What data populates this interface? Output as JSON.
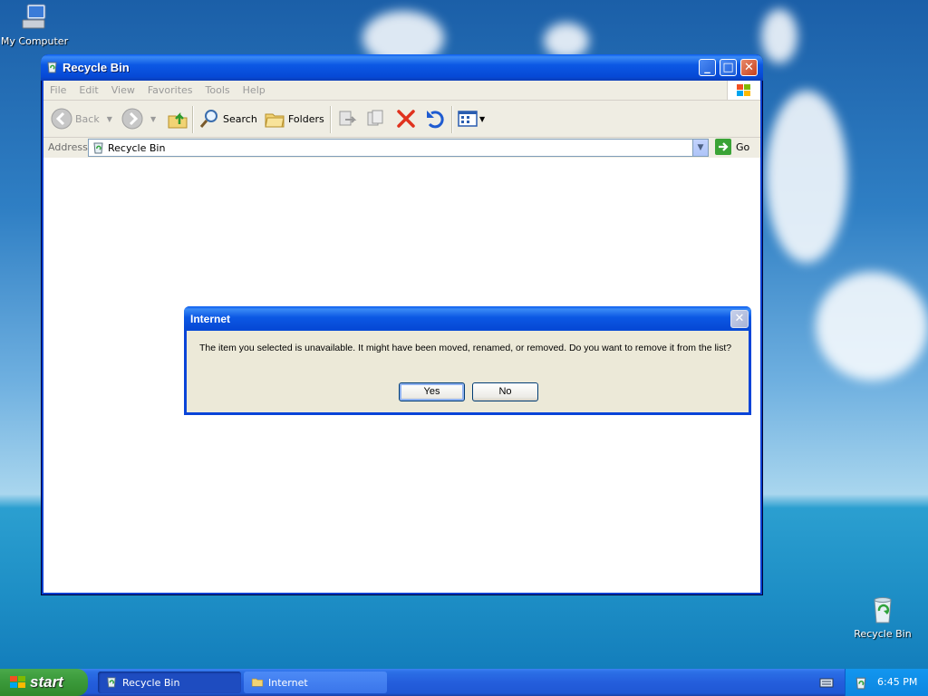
{
  "desktop": {
    "icons": [
      {
        "label": "My Computer"
      },
      {
        "label": "Recycle Bin"
      }
    ]
  },
  "window": {
    "title": "Recycle Bin",
    "menu": [
      "File",
      "Edit",
      "View",
      "Favorites",
      "Tools",
      "Help"
    ],
    "toolbar": {
      "back_label": "Back",
      "search_label": "Search",
      "folders_label": "Folders"
    },
    "address": {
      "label": "Address",
      "value": "Recycle Bin",
      "go_label": "Go"
    }
  },
  "dialog": {
    "title": "Internet",
    "message": "The item you selected is unavailable.  It might have been moved, renamed, or removed.  Do you want to remove it from the list?",
    "yes_label": "Yes",
    "no_label": "No"
  },
  "taskbar": {
    "start_label": "start",
    "tasks": [
      {
        "label": "Recycle Bin",
        "active": true
      },
      {
        "label": "Internet",
        "active": false
      }
    ],
    "clock": "6:45 PM"
  },
  "colors": {
    "titlebar": "#0a5cf0",
    "taskbar": "#245edc",
    "start": "#3c9b3c",
    "dialog_face": "#ece9d8"
  }
}
